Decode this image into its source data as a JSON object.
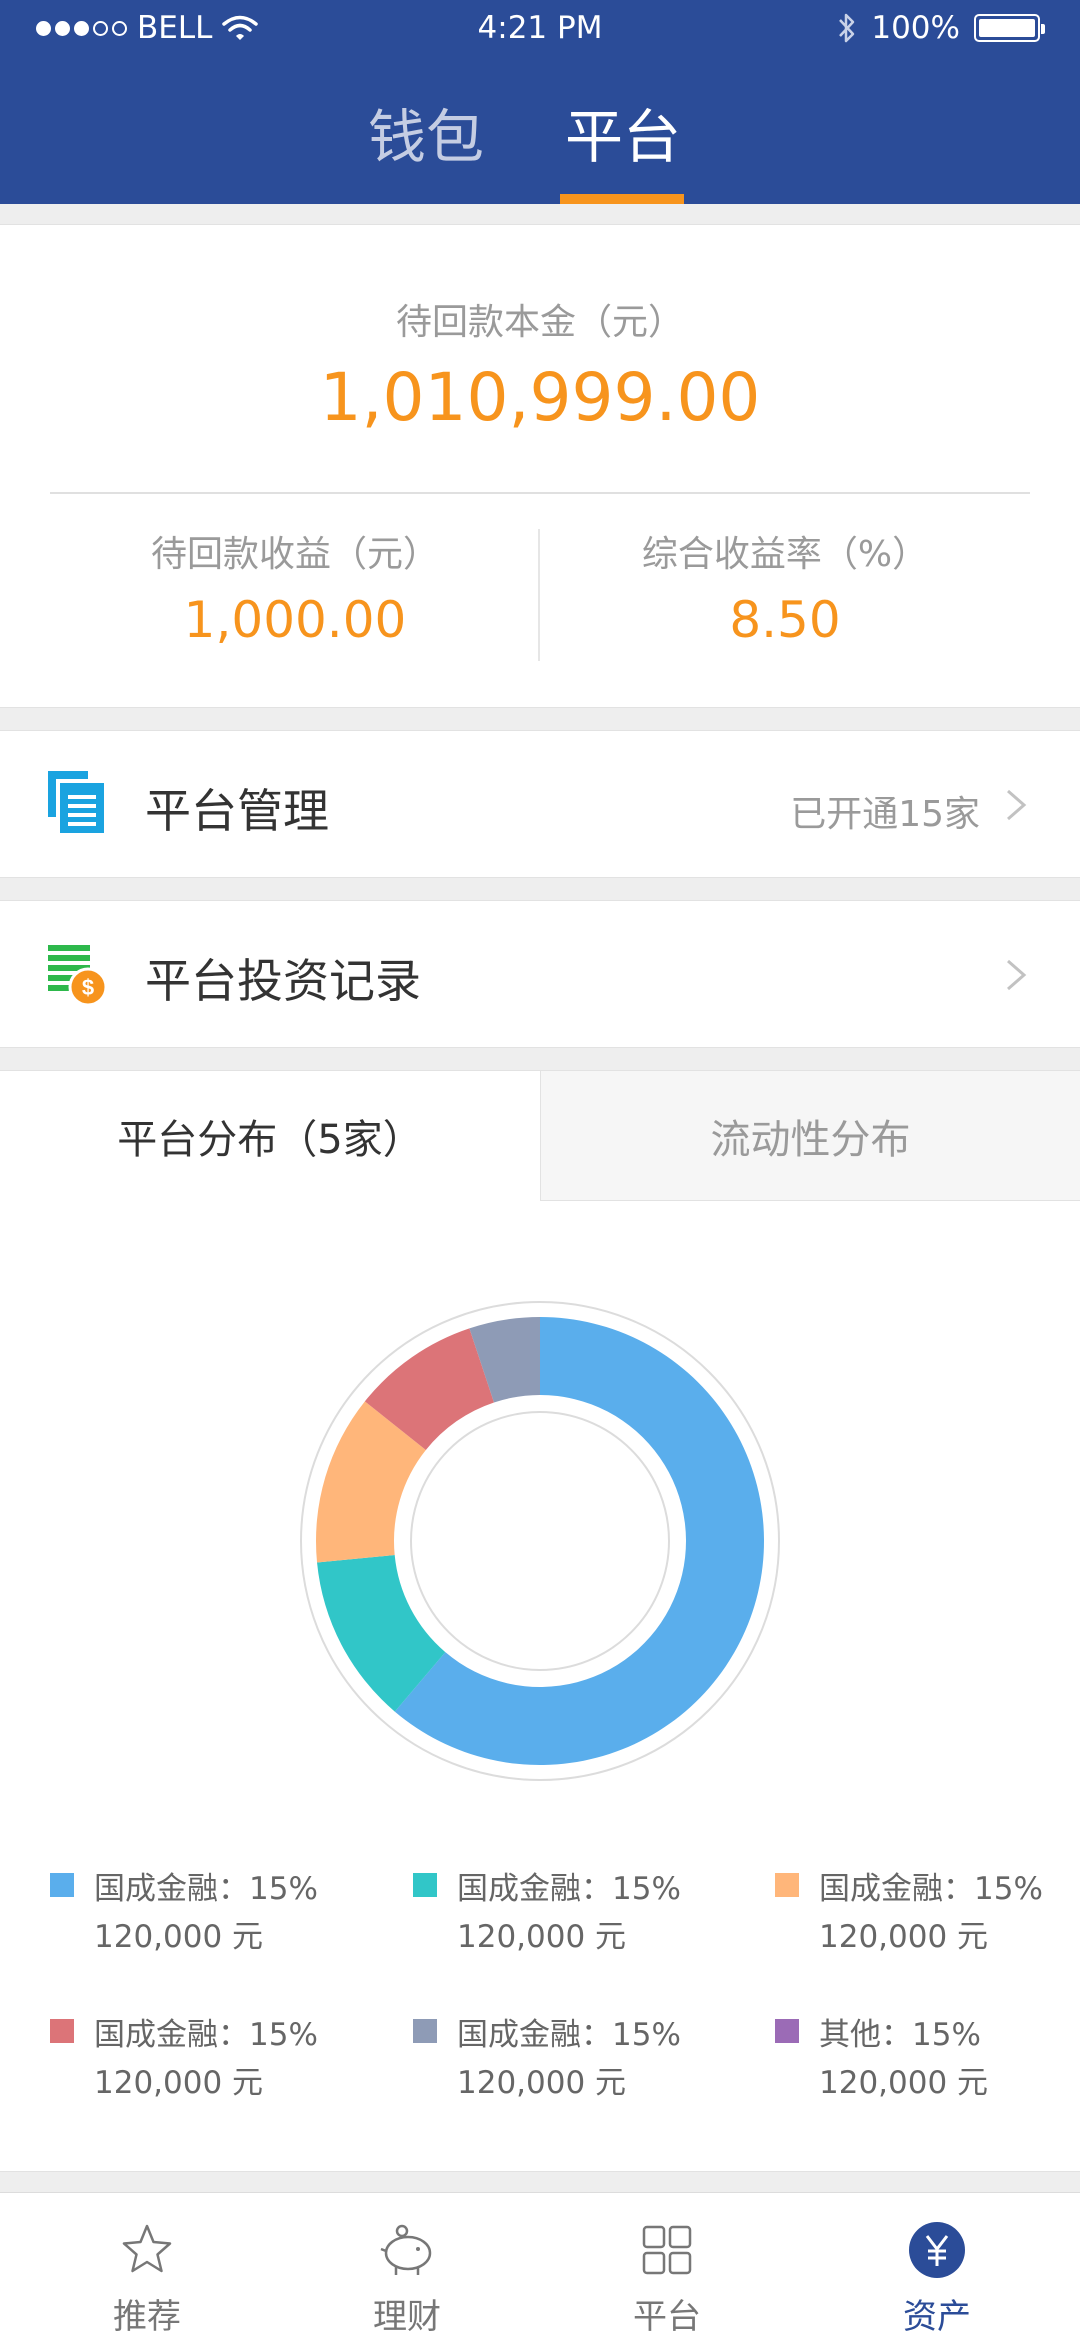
{
  "status_bar": {
    "carrier": "BELL",
    "time": "4:21 PM",
    "battery": "100%"
  },
  "top_tabs": [
    {
      "label": "钱包",
      "active": false
    },
    {
      "label": "平台",
      "active": true
    }
  ],
  "summary": {
    "principal_label": "待回款本金（元）",
    "principal_value": "1,010,999.00",
    "income_label": "待回款收益（元）",
    "income_value": "1,000.00",
    "rate_label": "综合收益率（%）",
    "rate_value": "8.50"
  },
  "rows": {
    "manage": {
      "title": "平台管理",
      "note": "已开通15家",
      "icon": "document-stack-icon"
    },
    "records": {
      "title": "平台投资记录",
      "icon": "coin-stack-icon"
    }
  },
  "distribution": {
    "tabs": [
      {
        "label": "平台分布（5家）",
        "active": true
      },
      {
        "label": "流动性分布",
        "active": false
      }
    ]
  },
  "chart_data": {
    "type": "pie",
    "categories": [
      "国成金融",
      "国成金融",
      "国成金融",
      "国成金融",
      "国成金融",
      "其他"
    ],
    "values": [
      60,
      12,
      12,
      9,
      5,
      0
    ],
    "colors": [
      "#5aaeec",
      "#31c6c8",
      "#ffb67a",
      "#dc7478",
      "#8e9bb6",
      "#9b6bb6"
    ]
  },
  "legend": [
    {
      "name": "国成金融：15%",
      "amount": "120,000 元",
      "color": "#5aaeec"
    },
    {
      "name": "国成金融：15%",
      "amount": "120,000 元",
      "color": "#31c6c8"
    },
    {
      "name": "国成金融：15%",
      "amount": "120,000 元",
      "color": "#ffb67a"
    },
    {
      "name": "国成金融：15%",
      "amount": "120,000 元",
      "color": "#dc7478"
    },
    {
      "name": "国成金融：15%",
      "amount": "120,000 元",
      "color": "#8e9bb6"
    },
    {
      "name": "其他：15%",
      "amount": "120,000 元",
      "color": "#9b6bb6"
    }
  ],
  "tab_bar": [
    {
      "label": "推荐",
      "icon": "star-icon",
      "active": false
    },
    {
      "label": "理财",
      "icon": "piggy-bank-icon",
      "active": false
    },
    {
      "label": "平台",
      "icon": "grid-icon",
      "active": false
    },
    {
      "label": "资产",
      "icon": "yuan-icon",
      "active": true
    }
  ]
}
